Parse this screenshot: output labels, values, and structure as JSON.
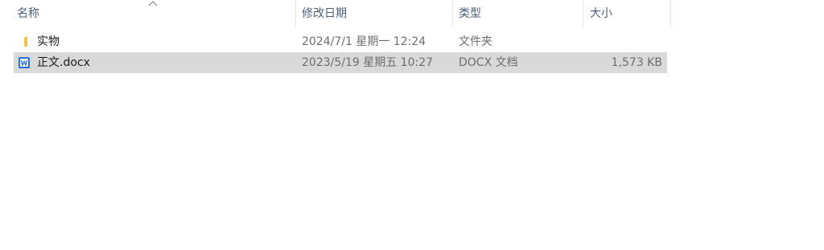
{
  "columns": {
    "name": "名称",
    "modified": "修改日期",
    "type": "类型",
    "size": "大小"
  },
  "sort": {
    "column": "name",
    "direction": "ascending",
    "icon": "chevron-up-icon"
  },
  "files": [
    {
      "name": "实物",
      "modified": "2024/7/1 星期一 12:24",
      "type": "文件夹",
      "size": "",
      "icon": "folder-icon",
      "selected": false
    },
    {
      "name": "正文.docx",
      "modified": "2023/5/19 星期五 10:27",
      "type": "DOCX 文档",
      "size": "1,573 KB",
      "icon": "wps-writer-icon",
      "selected": true
    }
  ],
  "colors": {
    "header_text": "#4c607a",
    "selected_row": "#d9d9d9",
    "folder": "#f5c84b",
    "doc_icon": "#2f6fde"
  }
}
